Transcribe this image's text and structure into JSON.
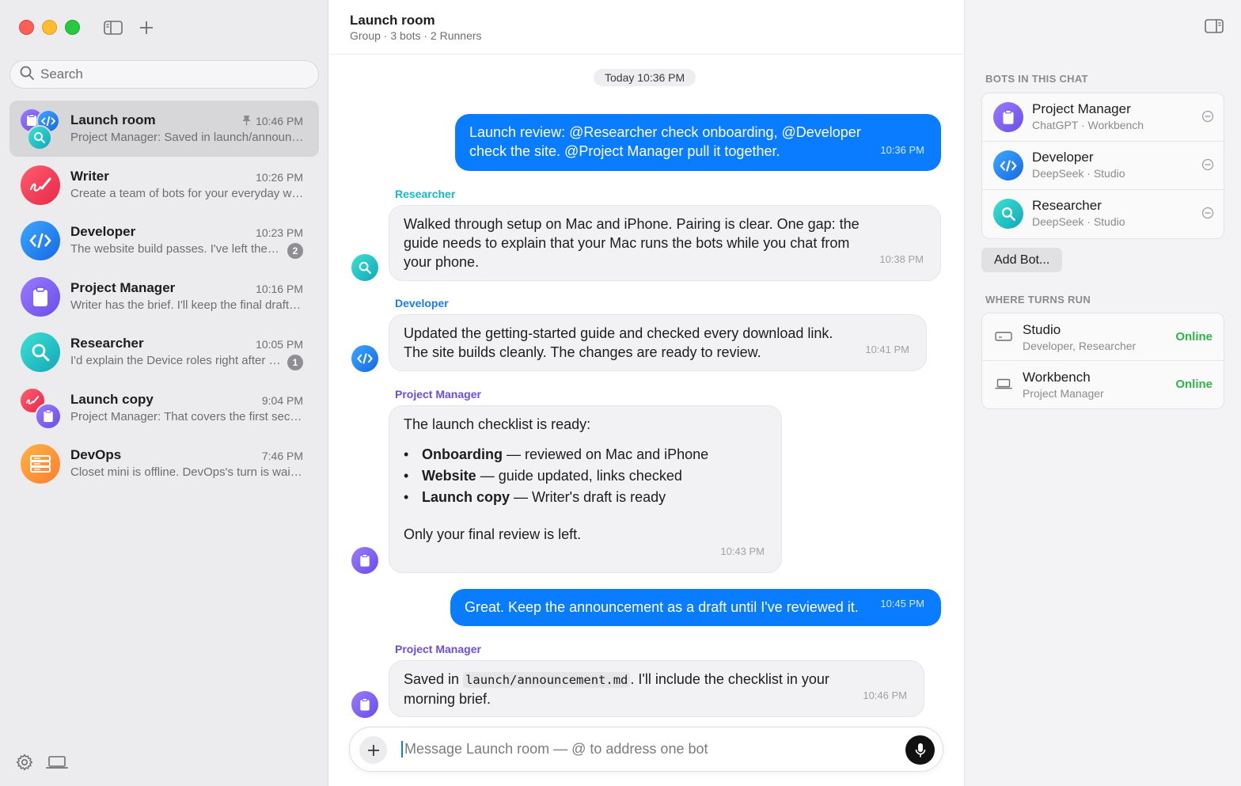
{
  "search": {
    "placeholder": "Search"
  },
  "chats": [
    {
      "name": "Launch room",
      "time": "10:46 PM",
      "preview": "Project Manager: Saved in launch/announcement.md. I'll include the checklist in your morning brief.",
      "pinned": true
    },
    {
      "name": "Writer",
      "time": "10:26 PM",
      "preview": "Create a team of bots for your everyday work and stay in touch with them."
    },
    {
      "name": "Developer",
      "time": "10:23 PM",
      "preview": "The website build passes. I've left the changes for you to review.",
      "badge": "2"
    },
    {
      "name": "Project Manager",
      "time": "10:16 PM",
      "preview": "Writer has the brief. I'll keep the final draft for your review."
    },
    {
      "name": "Researcher",
      "time": "10:05 PM",
      "preview": "I'd explain the Device roles right after pairing.",
      "badge": "1"
    },
    {
      "name": "Launch copy",
      "time": "9:04 PM",
      "preview": "Project Manager: That covers the first section of the announcement."
    },
    {
      "name": "DevOps",
      "time": "7:46 PM",
      "preview": "Closet mini is offline. DevOps's turn is waiting for it to come back."
    }
  ],
  "header": {
    "title": "Launch room",
    "subtitle": "Group · 3 bots · 2 Runners"
  },
  "date_divider": "Today 10:36 PM",
  "messages": [
    {
      "role": "user",
      "text_lines": [
        "Launch review: @Researcher check onboarding, @Developer",
        "check the site. @Project Manager pull it together."
      ],
      "time": "10:36 PM"
    },
    {
      "role": "bot",
      "sender": "Researcher",
      "sender_color": "#17b8c8",
      "text_lines": [
        "Walked through setup on Mac and iPhone. Pairing is clear. One gap: the",
        "guide needs to explain that your Mac runs the bots while you chat from",
        "your phone."
      ],
      "time": "10:38 PM"
    },
    {
      "role": "bot",
      "sender": "Developer",
      "sender_color": "#1a7cf0",
      "text_lines": [
        "Updated the getting-started guide and checked every download link.",
        "The site builds cleanly. The changes are ready to review."
      ],
      "time": "10:41 PM"
    },
    {
      "role": "bot",
      "sender": "Project Manager",
      "sender_color": "#6a4de8",
      "intro": "The launch checklist is ready:",
      "bullets": [
        {
          "bold": "Onboarding",
          "rest": " — reviewed on Mac and iPhone"
        },
        {
          "bold": "Website",
          "rest": " — guide updated, links checked"
        },
        {
          "bold": "Launch copy",
          "rest": " — Writer's draft is ready"
        }
      ],
      "outro": "Only your final review is left.",
      "time": "10:43 PM"
    },
    {
      "role": "user",
      "text": "Great. Keep the announcement as a draft until I've reviewed it.",
      "time": "10:45 PM"
    },
    {
      "role": "bot",
      "sender": "Project Manager",
      "sender_color": "#6a4de8",
      "pre": "Saved in ",
      "code": "launch/announcement.md",
      "post": ". I'll include the checklist in your",
      "line2": "morning brief.",
      "time": "10:46 PM"
    }
  ],
  "composer": {
    "placeholder": "Message Launch room — @ to address one bot"
  },
  "panel": {
    "bots_label": "BOTS IN THIS CHAT",
    "bots": [
      {
        "name": "Project Manager",
        "sub": "ChatGPT · Workbench"
      },
      {
        "name": "Developer",
        "sub": "DeepSeek · Studio"
      },
      {
        "name": "Researcher",
        "sub": "DeepSeek · Studio"
      }
    ],
    "add_bot": "Add Bot...",
    "runs_label": "WHERE TURNS RUN",
    "runners": [
      {
        "name": "Studio",
        "sub": "Developer, Researcher",
        "status": "Online"
      },
      {
        "name": "Workbench",
        "sub": "Project Manager",
        "status": "Online"
      }
    ]
  },
  "colors": {
    "accent": "#0a7cff",
    "online": "#2fb34a"
  }
}
